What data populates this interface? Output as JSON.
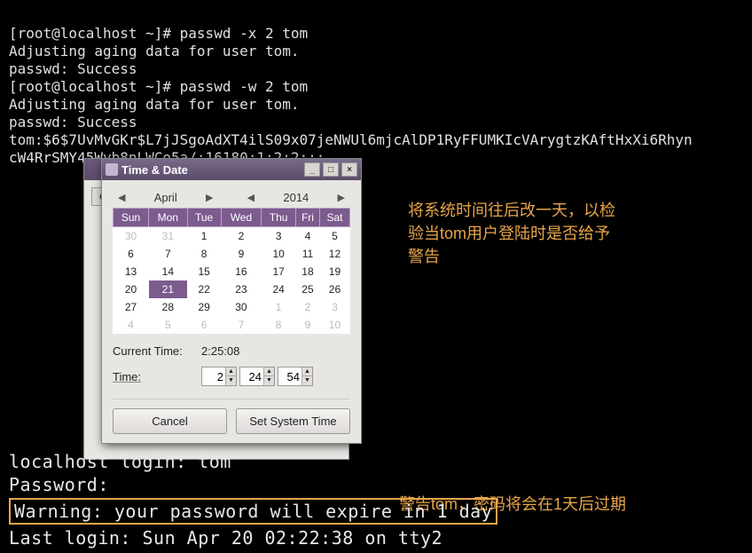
{
  "terminal": {
    "lines": [
      "[root@localhost ~]# passwd -x 2 tom",
      "Adjusting aging data for user tom.",
      "passwd: Success",
      "[root@localhost ~]# passwd -w 2 tom",
      "Adjusting aging data for user tom.",
      "passwd: Success",
      "tom:$6$7UvMvGKr$L7jJSgoAdXT4ilS09x07jeNWUl6mjcAlDP1RyFFUMKIcVArygtzKAftHxXi6Rhyn",
      "cW4RrSMY45Wyb8nLWCo5a/:16180:1:2:2:::"
    ]
  },
  "dialog": {
    "title": "Time & Date",
    "month": "April",
    "year": "2014",
    "dow": [
      "Sun",
      "Mon",
      "Tue",
      "Wed",
      "Thu",
      "Fri",
      "Sat"
    ],
    "weeks": [
      [
        {
          "d": "30",
          "o": true
        },
        {
          "d": "31",
          "o": true
        },
        {
          "d": "1"
        },
        {
          "d": "2"
        },
        {
          "d": "3"
        },
        {
          "d": "4"
        },
        {
          "d": "5"
        }
      ],
      [
        {
          "d": "6"
        },
        {
          "d": "7"
        },
        {
          "d": "8"
        },
        {
          "d": "9"
        },
        {
          "d": "10"
        },
        {
          "d": "11"
        },
        {
          "d": "12"
        }
      ],
      [
        {
          "d": "13"
        },
        {
          "d": "14"
        },
        {
          "d": "15"
        },
        {
          "d": "16"
        },
        {
          "d": "17"
        },
        {
          "d": "18"
        },
        {
          "d": "19"
        }
      ],
      [
        {
          "d": "20"
        },
        {
          "d": "21",
          "sel": true
        },
        {
          "d": "22"
        },
        {
          "d": "23"
        },
        {
          "d": "24"
        },
        {
          "d": "25"
        },
        {
          "d": "26"
        }
      ],
      [
        {
          "d": "27"
        },
        {
          "d": "28"
        },
        {
          "d": "29"
        },
        {
          "d": "30"
        },
        {
          "d": "1",
          "o": true
        },
        {
          "d": "2",
          "o": true
        },
        {
          "d": "3",
          "o": true
        }
      ],
      [
        {
          "d": "4",
          "o": true
        },
        {
          "d": "5",
          "o": true
        },
        {
          "d": "6",
          "o": true
        },
        {
          "d": "7",
          "o": true
        },
        {
          "d": "8",
          "o": true
        },
        {
          "d": "9",
          "o": true
        },
        {
          "d": "10",
          "o": true
        }
      ]
    ],
    "current_time_label": "Current Time:",
    "current_time_value": "2:25:08",
    "time_label": "Time:",
    "time_h": "2",
    "time_m": "24",
    "time_s": "54",
    "cancel": "Cancel",
    "set": "Set System Time",
    "bg_btn": "G"
  },
  "annot": {
    "a1": "将系统时间往后改一天，以检验当tom用户登陆时是否给予警告",
    "a2": "警告tom，密码将会在1天后过期"
  },
  "login": {
    "l1": "localhost login: tom",
    "l2": "Password:",
    "warn": "Warning: your password will expire in 1 day",
    "last": "Last login: Sun Apr 20 02:22:38 on tty2"
  }
}
